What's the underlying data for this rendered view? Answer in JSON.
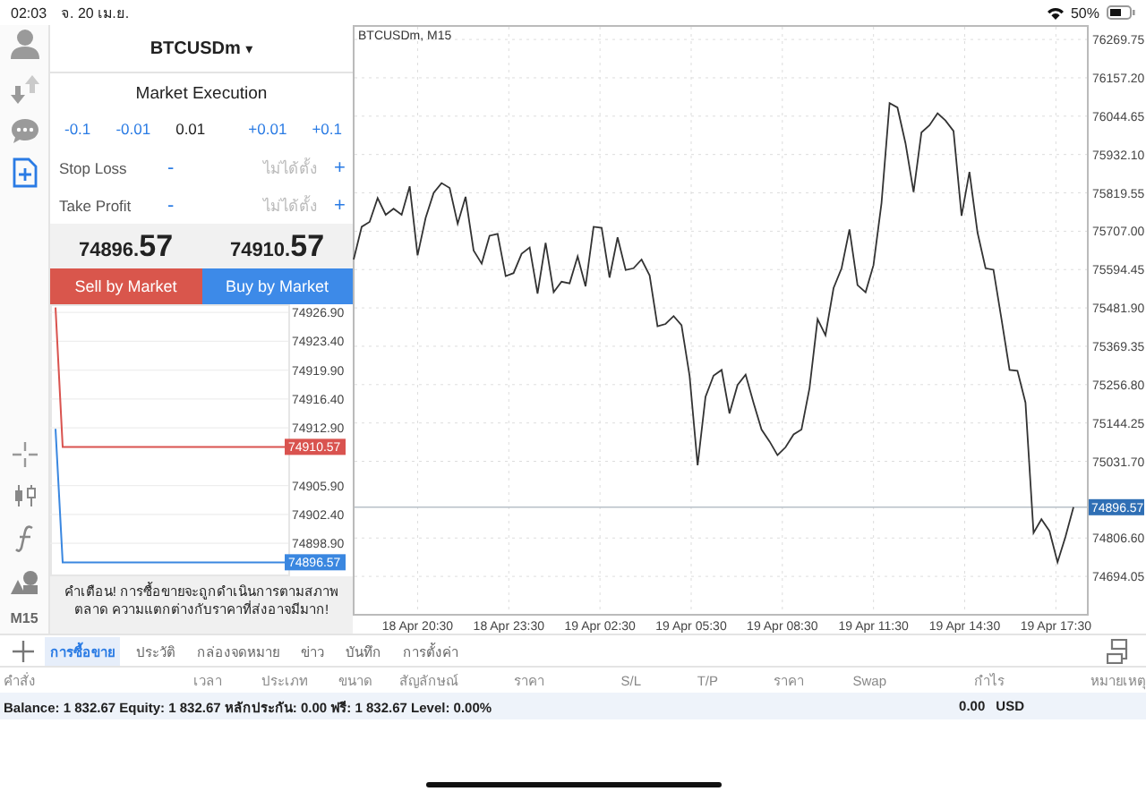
{
  "status_bar": {
    "time": "02:03",
    "date": "จ. 20 เม.ย.",
    "battery": "50%"
  },
  "tools": [
    {
      "kind": "account",
      "selected": false
    },
    {
      "kind": "transfer",
      "selected": false
    },
    {
      "kind": "chat",
      "selected": false
    },
    {
      "kind": "new-order",
      "selected": true
    }
  ],
  "chart_tools": [
    {
      "kind": "crosshair"
    },
    {
      "kind": "candles"
    },
    {
      "kind": "indicator"
    },
    {
      "kind": "objects"
    },
    {
      "kind": "timeframe",
      "label": "M15"
    }
  ],
  "order_panel": {
    "symbol": "BTCUSDm",
    "dropdown": "▾",
    "mode": "Market Execution",
    "volume": {
      "down": [
        "-0.1",
        "-0.01"
      ],
      "value": "0.01",
      "up": [
        "+0.01",
        "+0.1"
      ]
    },
    "stops": [
      {
        "label": "Stop Loss",
        "minus": "-",
        "placeholder": "ไม่ได้ตั้ง",
        "plus": "+"
      },
      {
        "label": "Take Profit",
        "minus": "-",
        "placeholder": "ไม่ได้ตั้ง",
        "plus": "+"
      }
    ],
    "prices": [
      {
        "main": "74896.",
        "pips": "57"
      },
      {
        "main": "74910.",
        "pips": "57"
      }
    ],
    "buttons": [
      {
        "kind": "sell",
        "label": "Sell by Market"
      },
      {
        "kind": "buy",
        "label": "Buy by Market"
      }
    ],
    "tick_chart": {
      "chart_data": {
        "type": "line",
        "grid": true,
        "ylim": [
          74894.9,
          74927.9
        ],
        "yticks": [
          {
            "value": 74926.9,
            "label": "74926.90"
          },
          {
            "value": 74923.4,
            "label": "74923.40"
          },
          {
            "value": 74919.9,
            "label": "74919.90"
          },
          {
            "value": 74916.4,
            "label": "74916.40"
          },
          {
            "value": 74912.9,
            "label": "74912.90"
          },
          {
            "value": 74905.9,
            "label": "74905.90"
          },
          {
            "value": 74902.4,
            "label": "74902.40"
          },
          {
            "value": 74898.9,
            "label": "74898.90"
          }
        ],
        "series": [
          {
            "color": "#d9534f",
            "values": [
              74927.5,
              74910.6,
              74910.6,
              74910.6,
              74910.6,
              74910.6,
              74910.6,
              74910.6,
              74910.6,
              74910.6,
              74910.6,
              74910.6,
              74910.6,
              74910.6,
              74910.6,
              74910.6,
              74910.6,
              74910.6,
              74910.6,
              74910.6,
              74910.6,
              74910.6,
              74910.6,
              74910.6,
              74910.6,
              74910.6,
              74910.6,
              74910.6,
              74910.6,
              74910.6,
              74910.6,
              74910.6,
              74910.6
            ]
          },
          {
            "color": "#3a87e0",
            "values": [
              74912.8,
              74896.6,
              74896.6,
              74896.6,
              74896.6,
              74896.6,
              74896.6,
              74896.6,
              74896.6,
              74896.6,
              74896.6,
              74896.6,
              74896.6,
              74896.6,
              74896.6,
              74896.6,
              74896.6,
              74896.6,
              74896.6,
              74896.6,
              74896.6,
              74896.6,
              74896.6,
              74896.6,
              74896.6,
              74896.6,
              74896.6,
              74896.6,
              74896.6,
              74896.6,
              74896.6,
              74896.6,
              74896.6
            ]
          }
        ]
      },
      "price_tags": [
        "74910.57",
        "74896.57"
      ]
    },
    "warning": "คำเตือน! การซื้อขายจะถูกดำเนินการตามสภาพตลาด ความแตกต่างกับราคาที่ส่งอาจมีมาก!"
  },
  "chart": {
    "chart_data": {
      "type": "line",
      "title": "BTCUSDm, M15",
      "grid": true,
      "ylim": [
        74584,
        76312
      ],
      "ref_lines": [
        {
          "axis": "y",
          "value": 74897
        }
      ],
      "yticks": [
        {
          "value": 76269.75,
          "label": "76269.75"
        },
        {
          "value": 76157.2,
          "label": "76157.20"
        },
        {
          "value": 76044.65,
          "label": "76044.65"
        },
        {
          "value": 75932.1,
          "label": "75932.10"
        },
        {
          "value": 75819.55,
          "label": "75819.55"
        },
        {
          "value": 75707,
          "label": "75707.00"
        },
        {
          "value": 75594.45,
          "label": "75594.45"
        },
        {
          "value": 75481.9,
          "label": "75481.90"
        },
        {
          "value": 75369.35,
          "label": "75369.35"
        },
        {
          "value": 75256.8,
          "label": "75256.80"
        },
        {
          "value": 75144.25,
          "label": "75144.25"
        },
        {
          "value": 75031.7,
          "label": "75031.70"
        },
        {
          "value": 74806.6,
          "label": "74806.60"
        },
        {
          "value": 74694.05,
          "label": "74694.05"
        }
      ],
      "series": [
        {
          "color": "#333333",
          "values": [
            75624,
            75720,
            75734,
            75804,
            75755,
            75773,
            75755,
            75839,
            75636,
            75746,
            75820,
            75848,
            75834,
            75729,
            75808,
            75650,
            75612,
            75694,
            75699,
            75575,
            75584,
            75641,
            75659,
            75524,
            75673,
            75528,
            75559,
            75554,
            75633,
            75545,
            75720,
            75717,
            75571,
            75689,
            75593,
            75598,
            75624,
            75577,
            75428,
            75435,
            75458,
            75431,
            75283,
            75020,
            75221,
            75283,
            75300,
            75172,
            75256,
            75286,
            75204,
            75125,
            75090,
            75050,
            75073,
            75111,
            75125,
            75247,
            75449,
            75402,
            75540,
            75598,
            75712,
            75549,
            75528,
            75607,
            75790,
            76083,
            76070,
            75965,
            75822,
            75997,
            76018,
            76053,
            76032,
            76001,
            75752,
            75881,
            75703,
            75598,
            75594,
            75449,
            75300,
            75297,
            75204,
            74822,
            74862,
            74827,
            74736,
            74810,
            74897
          ]
        }
      ]
    },
    "x_labels": [
      "18 Apr 20:30",
      "18 Apr 23:30",
      "19 Apr 02:30",
      "19 Apr 05:30",
      "19 Apr 08:30",
      "19 Apr 11:30",
      "19 Apr 14:30",
      "19 Apr 17:30"
    ],
    "price_tag": "74896.57"
  },
  "bottom_tabs": [
    {
      "label": "การซื้อขาย",
      "selected": true
    },
    {
      "label": "ประวัติ",
      "selected": false
    },
    {
      "label": "กล่องจดหมาย",
      "selected": false
    },
    {
      "label": "ข่าว",
      "selected": false
    },
    {
      "label": "บันทึก",
      "selected": false
    },
    {
      "label": "การตั้งค่า",
      "selected": false
    }
  ],
  "columns": [
    "คำสั่ง",
    "เวลา",
    "ประเภท",
    "ขนาด",
    "สัญลักษณ์",
    "ราคา",
    "S/L",
    "T/P",
    "ราคา",
    "Swap",
    "กำไร",
    "หมายเหตุ"
  ],
  "summary": {
    "text": "Balance: 1 832.67 Equity: 1 832.67 หลักประกัน: 0.00 ฟรี: 1 832.67 Level: 0.00%",
    "profit": "0.00",
    "currency": "USD"
  }
}
